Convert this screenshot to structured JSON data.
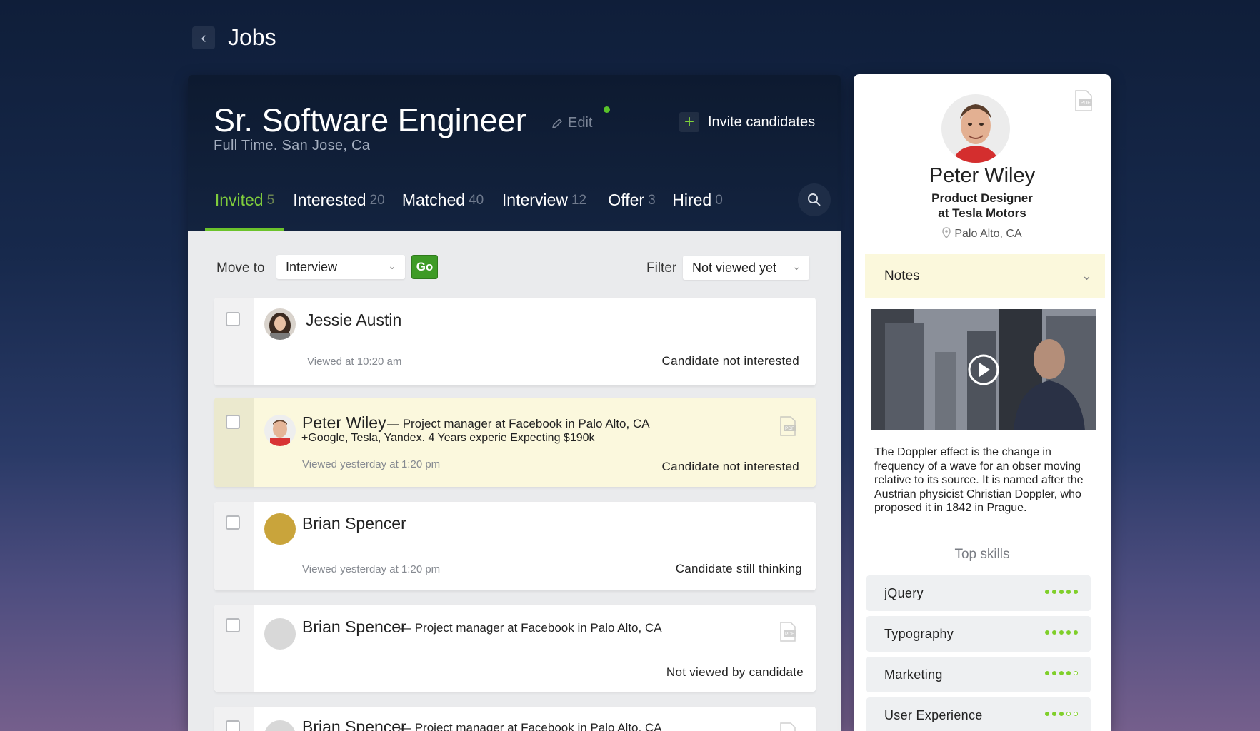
{
  "page": {
    "title": "Jobs"
  },
  "job": {
    "title": "Sr. Software Engineer",
    "subtitle": "Full Time. San Jose, Ca",
    "edit_label": "Edit",
    "invite_label": "Invite candidates"
  },
  "tabs": [
    {
      "label": "Invited",
      "count": "5"
    },
    {
      "label": "Interested",
      "count": "20"
    },
    {
      "label": "Matched",
      "count": "40"
    },
    {
      "label": "Interview",
      "count": "12"
    },
    {
      "label": "Offer",
      "count": "3"
    },
    {
      "label": "Hired",
      "count": "0"
    }
  ],
  "toolbar": {
    "move_to_label": "Move to",
    "move_to_value": "Interview",
    "go_label": "Go",
    "filter_label": "Filter",
    "filter_value": "Not viewed yet"
  },
  "candidates": [
    {
      "name": "Jessie Austin",
      "viewed": "Viewed at 10:20 am",
      "status": "Candidate not interested"
    },
    {
      "name": "Peter Wiley",
      "desc": "— Project manager at Facebook in Palo Alto, CA",
      "desc2": "+Google, Tesla, Yandex. 4 Years experie  Expecting  $190k",
      "viewed": "Viewed yesterday at 1:20 pm",
      "status": "Candidate not interested"
    },
    {
      "name": "Brian Spencer",
      "viewed": "Viewed yesterday at 1:20 pm",
      "status": "Candidate still thinking"
    },
    {
      "name": "Brian Spencer",
      "desc": "— Project manager at Facebook in Palo Alto, CA",
      "status": "Not viewed by candidate"
    },
    {
      "name": "Brian Spencer",
      "desc": "— Project manager at Facebook in Palo Alto, CA"
    }
  ],
  "profile": {
    "name": "Peter Wiley",
    "role_line1": "Product Designer",
    "role_line2": "at Tesla Motors",
    "location": "Palo Alto, CA",
    "notes_label": "Notes",
    "bio": "The Doppler effect  is the change in frequency of a wave  for an obser moving relative to its source. It is named after the Austrian physicist Christian Doppler, who proposed it in 1842 in Prague.",
    "skills_title": "Top skills",
    "skills": [
      {
        "name": "jQuery",
        "level": 5
      },
      {
        "name": "Typography",
        "level": 5
      },
      {
        "name": "Marketing",
        "level": 4
      },
      {
        "name": "User Experience",
        "level": 3
      }
    ]
  },
  "colors": {
    "accent": "#6cc32c",
    "go_button": "#3e9b26",
    "highlight_row": "#fbf8dd",
    "panel_dark": "#0d1a30"
  }
}
